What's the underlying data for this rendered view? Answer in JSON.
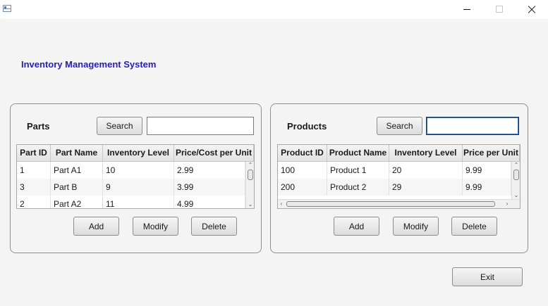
{
  "window": {
    "title": ""
  },
  "app": {
    "title": "Inventory Management System"
  },
  "parts": {
    "title": "Parts",
    "search_label": "Search",
    "search_value": "",
    "columns": [
      "Part ID",
      "Part Name",
      "Inventory Level",
      "Price/Cost per Unit"
    ],
    "rows": [
      [
        "1",
        "Part A1",
        "10",
        "2.99"
      ],
      [
        "3",
        "Part B",
        "9",
        "3.99"
      ],
      [
        "2",
        "Part A2",
        "11",
        "4.99"
      ]
    ],
    "add_label": "Add",
    "modify_label": "Modify",
    "delete_label": "Delete"
  },
  "products": {
    "title": "Products",
    "search_label": "Search",
    "search_value": "",
    "columns": [
      "Product ID",
      "Product Name",
      "Inventory Level",
      "Price per Unit"
    ],
    "rows": [
      [
        "100",
        "Product 1",
        "20",
        "9.99"
      ],
      [
        "200",
        "Product 2",
        "29",
        "9.99"
      ]
    ],
    "add_label": "Add",
    "modify_label": "Modify",
    "delete_label": "Delete"
  },
  "exit_label": "Exit"
}
